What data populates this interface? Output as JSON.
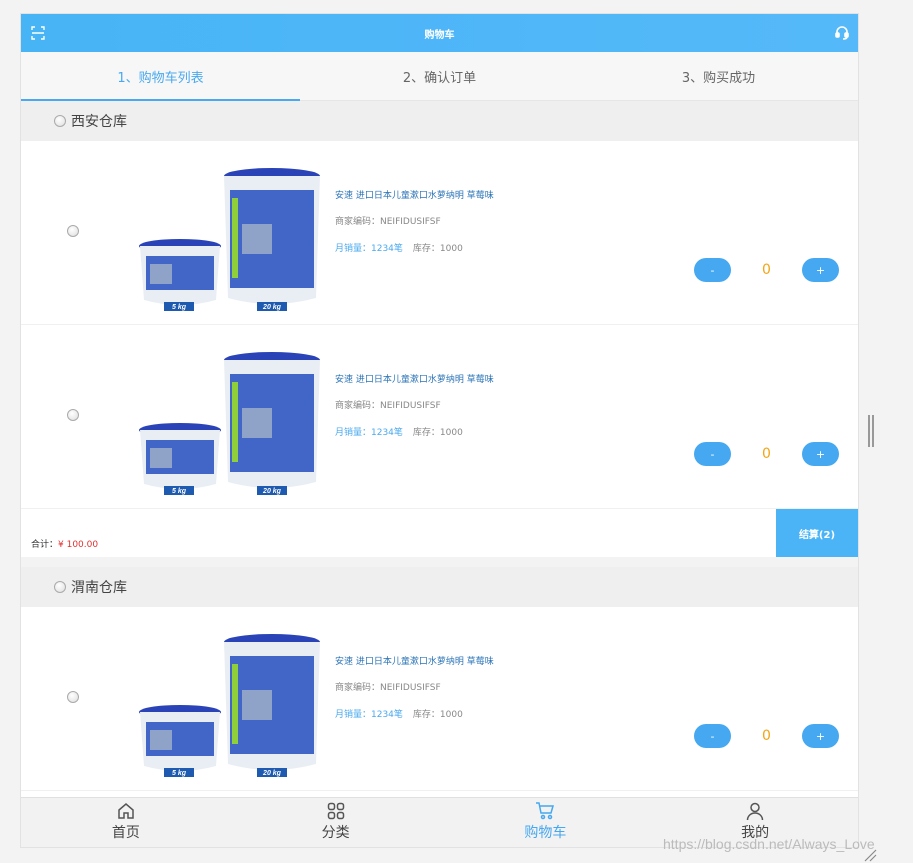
{
  "header": {
    "title": "购物车",
    "left_icon": "scan-icon",
    "right_icon": "headset-icon"
  },
  "steps": [
    {
      "label": "1、购物车列表",
      "active": true
    },
    {
      "label": "2、确认订单",
      "active": false
    },
    {
      "label": "3、购买成功",
      "active": false
    }
  ],
  "warehouses": [
    {
      "name": "西安仓库",
      "items": [
        {
          "name": "安速 进口日本儿童漱口水萝纳明 草莓味",
          "code": "商家编码：NEIFIDUSIFSF",
          "sales": "月销量：1234笔",
          "stock": "库存：1000",
          "qty": "0",
          "minus": "-",
          "plus": "+",
          "img_labels": [
            "5 kg",
            "20 kg"
          ]
        },
        {
          "name": "安速 进口日本儿童漱口水萝纳明 草莓味",
          "code": "商家编码：NEIFIDUSIFSF",
          "sales": "月销量：1234笔",
          "stock": "库存：1000",
          "qty": "0",
          "minus": "-",
          "plus": "+",
          "img_labels": [
            "5 kg",
            "20 kg"
          ]
        }
      ],
      "total_label": "合计：",
      "total_amount": "¥ 100.00",
      "checkout": "结算(2)"
    },
    {
      "name": "渭南仓库",
      "items": [
        {
          "name": "安速 进口日本儿童漱口水萝纳明 草莓味",
          "code": "商家编码：NEIFIDUSIFSF",
          "sales": "月销量：1234笔",
          "stock": "库存：1000",
          "qty": "0",
          "minus": "-",
          "plus": "+",
          "img_labels": [
            "5 kg",
            "20 kg"
          ]
        }
      ]
    }
  ],
  "tabbar": [
    {
      "label": "首页",
      "icon": "home-icon",
      "active": false
    },
    {
      "label": "分类",
      "icon": "grid-icon",
      "active": false
    },
    {
      "label": "购物车",
      "icon": "cart-icon",
      "active": true
    },
    {
      "label": "我的",
      "icon": "user-icon",
      "active": false
    }
  ],
  "watermark": "https://blog.csdn.net/Always_Love",
  "colors": {
    "accent": "#45a8f0",
    "qty": "#f2a516",
    "price": "#e03030"
  }
}
